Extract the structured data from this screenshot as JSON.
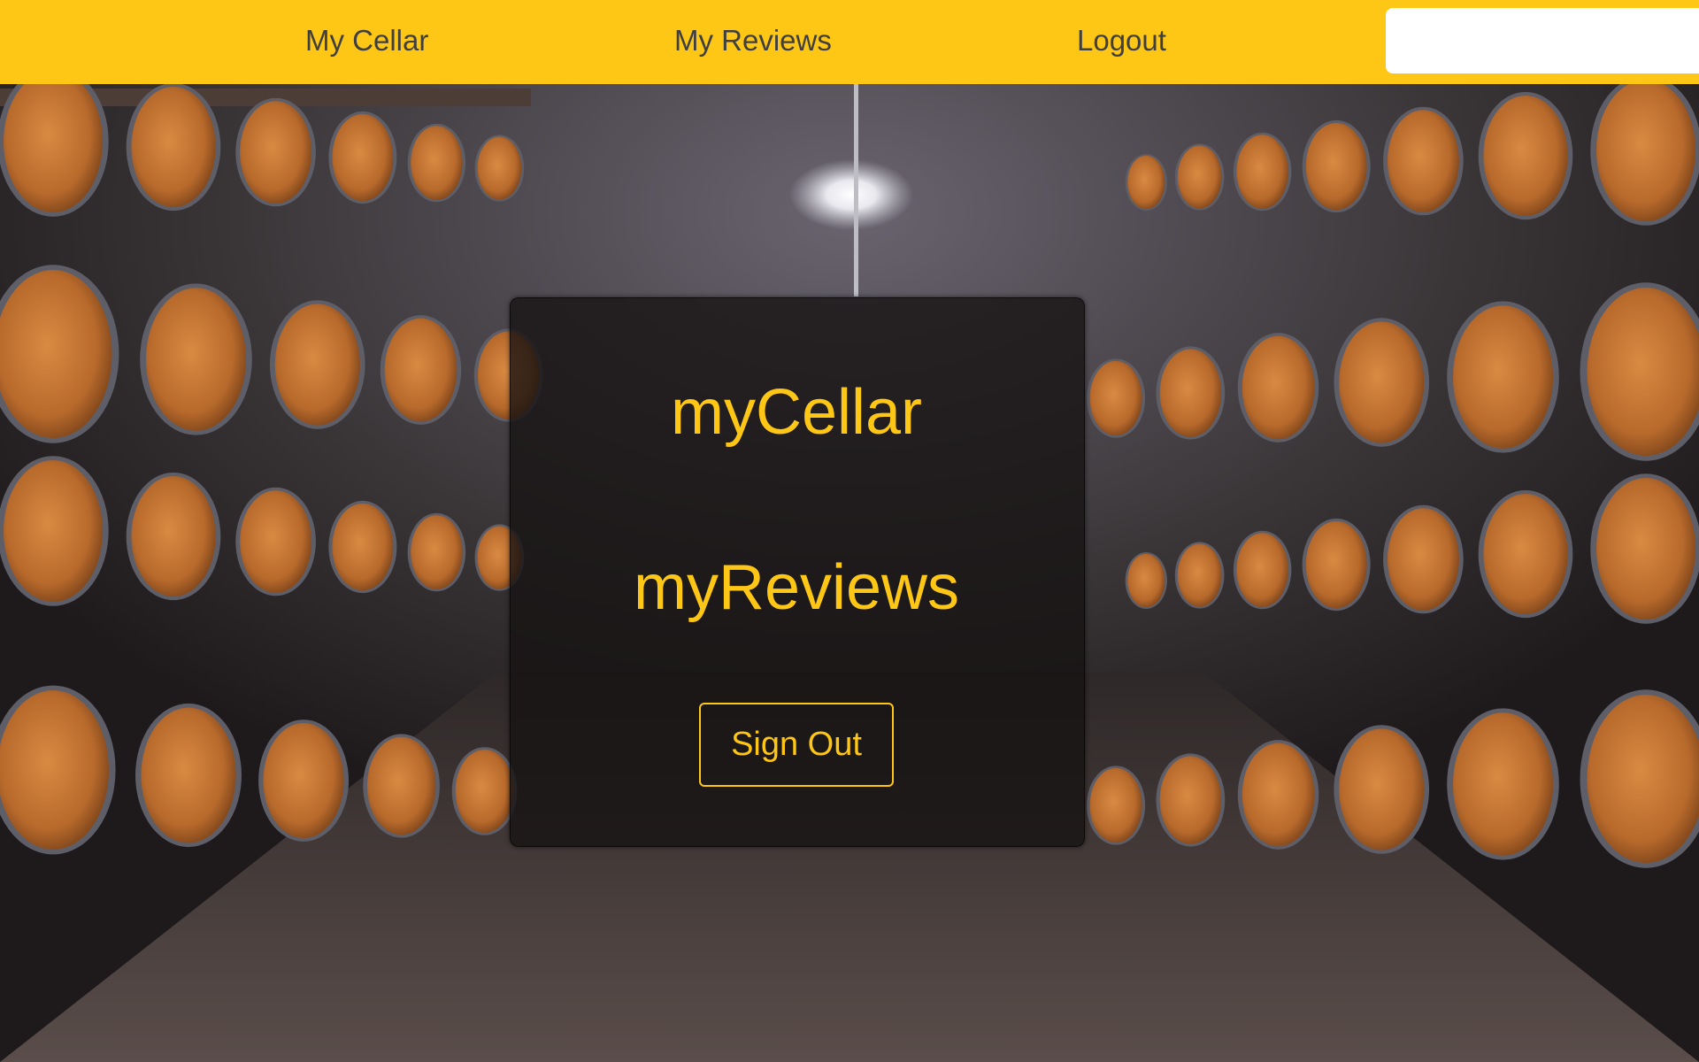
{
  "nav": {
    "links": [
      {
        "label": "My Cellar"
      },
      {
        "label": "My Reviews"
      },
      {
        "label": "Logout"
      }
    ],
    "search": {
      "value": "",
      "placeholder": ""
    }
  },
  "panel": {
    "title_cellar": "myCellar",
    "title_reviews": "myReviews",
    "signout_label": "Sign Out"
  },
  "colors": {
    "accent": "#fec615",
    "nav_text": "#3f3f3f",
    "panel_bg": "#161212",
    "barrel_wood": "#c9803d",
    "barrel_hoop": "#6e6e78",
    "floor": "#5a4d4a"
  }
}
